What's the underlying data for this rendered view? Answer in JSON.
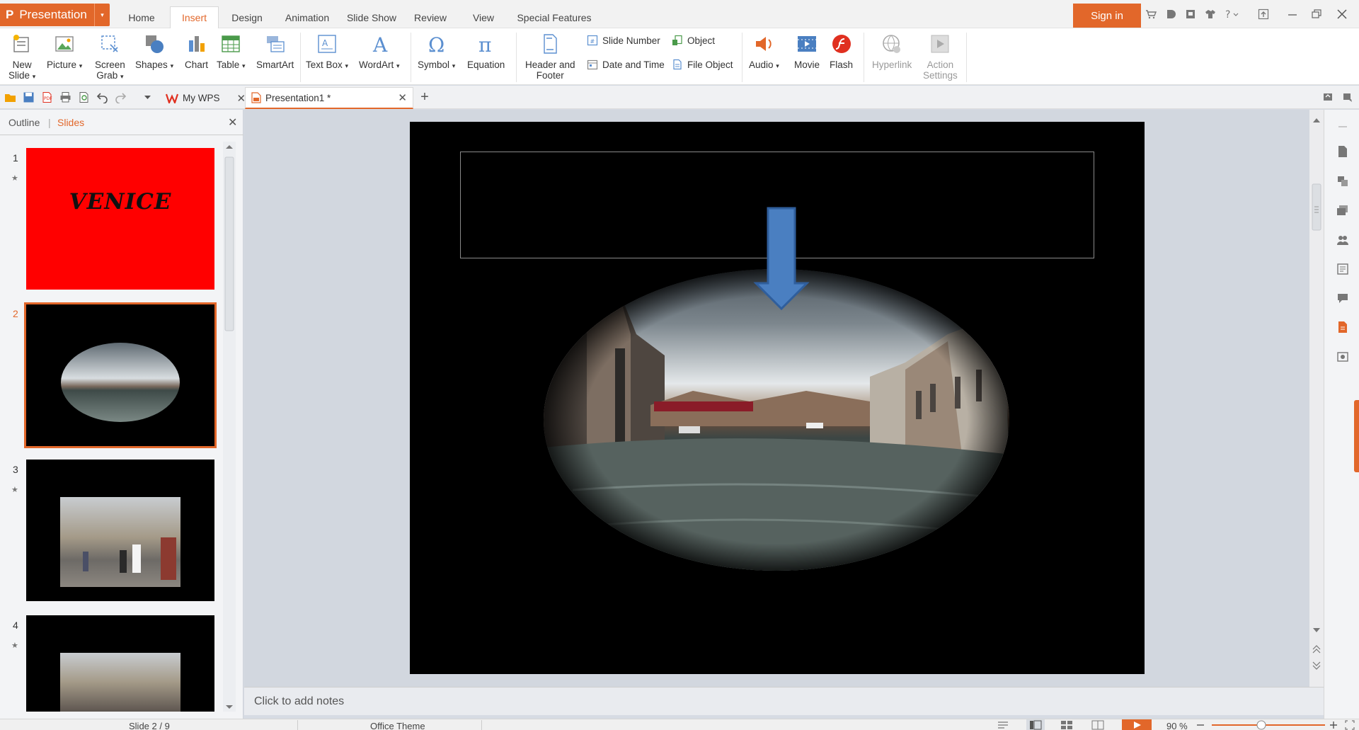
{
  "app": {
    "name": "Presentation",
    "logo_glyph": "P"
  },
  "menu": {
    "tabs": [
      {
        "label": "Home"
      },
      {
        "label": "Insert"
      },
      {
        "label": "Design"
      },
      {
        "label": "Animation"
      },
      {
        "label": "Slide Show"
      },
      {
        "label": "Review"
      },
      {
        "label": "View"
      },
      {
        "label": "Special Features"
      }
    ],
    "active": "Insert",
    "sign_in": "Sign in"
  },
  "ribbon": {
    "new_slide": [
      "New",
      "Slide"
    ],
    "picture": "Picture",
    "screen_grab": [
      "Screen",
      "Grab"
    ],
    "shapes": "Shapes",
    "chart": "Chart",
    "table": "Table",
    "smartart": "SmartArt",
    "text_box": "Text Box",
    "wordart": "WordArt",
    "symbol": "Symbol",
    "equation": "Equation",
    "header_footer": [
      "Header and",
      "Footer"
    ],
    "slide_number": "Slide Number",
    "object": "Object",
    "date_time": "Date and Time",
    "file_object": "File Object",
    "audio": "Audio",
    "movie": "Movie",
    "flash": "Flash",
    "hyperlink": "Hyperlink",
    "action_settings": [
      "Action",
      "Settings"
    ],
    "dropdown_glyph": "▾"
  },
  "doc_tabs": {
    "my_wps": "My WPS",
    "presentation": "Presentation1 *",
    "close_glyph": "✕",
    "add_glyph": "+"
  },
  "left_pane": {
    "outline_tab": "Outline",
    "divider": "|",
    "slides_tab": "Slides",
    "close_glyph": "✕",
    "slides": [
      {
        "num": "1",
        "starred": true,
        "title": "VENICE"
      },
      {
        "num": "2",
        "starred": false
      },
      {
        "num": "3",
        "starred": true
      },
      {
        "num": "4",
        "starred": true
      }
    ],
    "star_glyph": "★"
  },
  "notes": {
    "placeholder": "Click to add notes"
  },
  "status": {
    "slide_info": "Slide 2 / 9",
    "theme": "Office Theme",
    "zoom": "90 %"
  },
  "colors": {
    "accent": "#e2672a",
    "arrow": "#4a7fc1",
    "slide1_bg": "#ff0000"
  }
}
